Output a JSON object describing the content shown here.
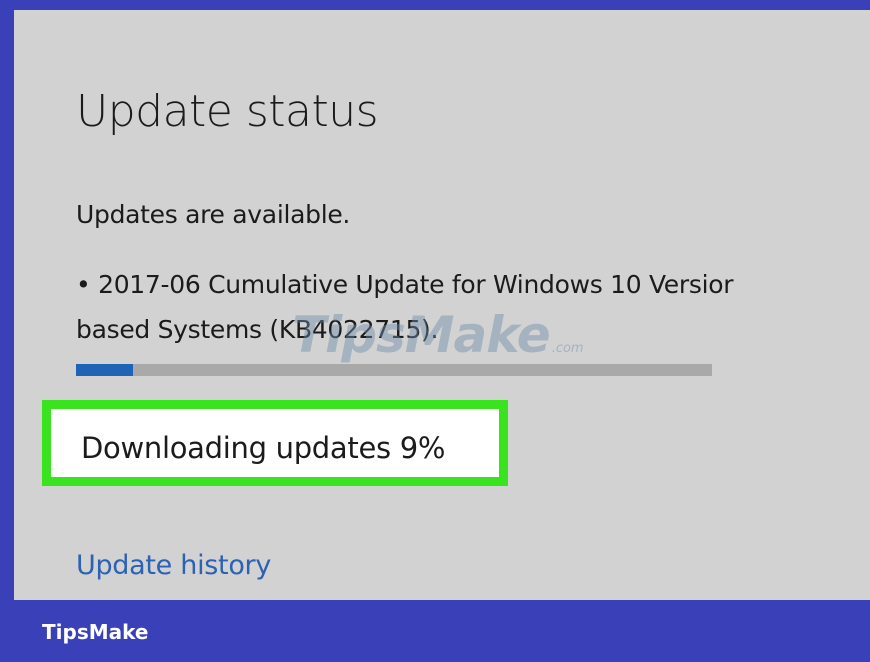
{
  "update_status": {
    "title": "Update status",
    "status_message": "Updates are available.",
    "update_item": {
      "line1": "• 2017-06 Cumulative Update for Windows 10 Versior",
      "line2": "based Systems (KB4022715)."
    },
    "progress": {
      "fraction": 0.09,
      "fill_color": "#1e63b5",
      "track_color": "#a9a9a9"
    },
    "download_status": "Downloading updates 9%",
    "history_link": "Update history"
  },
  "watermark": {
    "text": "TipsMake",
    "suffix": ".com"
  },
  "footer": {
    "brand": "TipsMake"
  },
  "colors": {
    "frame": "#3a41b8",
    "panel": "#d2d2d2",
    "highlight_border": "#39e31d",
    "link": "#2b62b3"
  }
}
